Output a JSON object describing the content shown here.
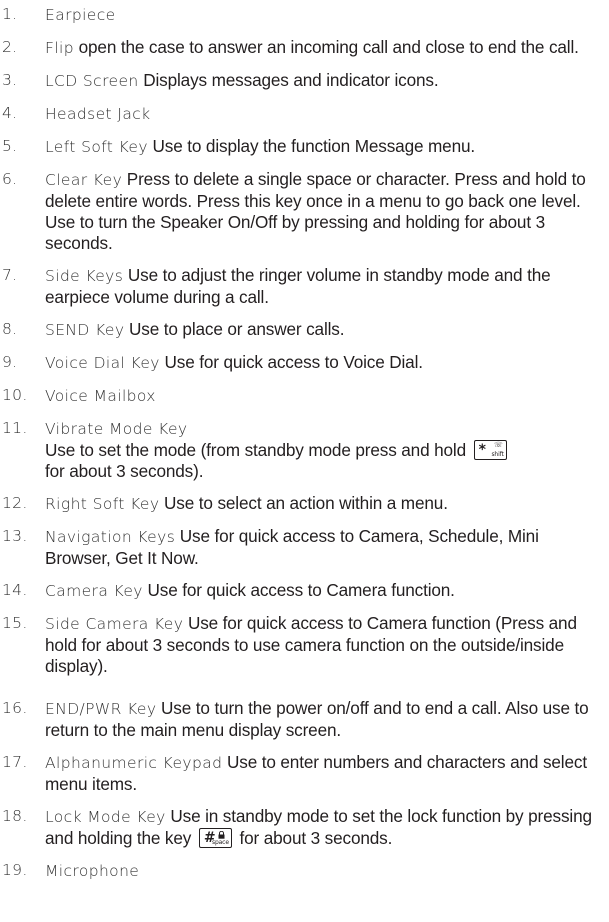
{
  "items": [
    {
      "num": "1.",
      "term": "Earpiece",
      "desc": ""
    },
    {
      "num": "2.",
      "term": "Flip",
      "desc": " open the case to answer an incoming call and close to end the call."
    },
    {
      "num": "3.",
      "term": "LCD Screen",
      "desc": " Displays messages and indicator icons."
    },
    {
      "num": "4.",
      "term": "Headset Jack",
      "desc": ""
    },
    {
      "num": "5.",
      "term": "Left Soft Key",
      "desc": " Use to display the function Message menu."
    },
    {
      "num": "6.",
      "term": "Clear Key",
      "desc": " Press to delete a single space or character. Press and hold to delete entire words. Press this key once in a menu to go back one level. Use to turn the Speaker On/Off by pressing and holding for about 3 seconds."
    },
    {
      "num": "7.",
      "term": "Side Keys",
      "desc": " Use to adjust the ringer volume in standby mode and the earpiece volume during a call."
    },
    {
      "num": "8.",
      "term": "SEND Key",
      "desc": " Use to place or answer calls."
    },
    {
      "num": "9.",
      "term": "Voice Dial Key",
      "desc": " Use for quick access to Voice Dial."
    },
    {
      "num": "10.",
      "term": "Voice Mailbox",
      "desc": ""
    },
    {
      "num": "11.",
      "term": "Vibrate Mode Key",
      "desc_before": "Use to set the mode (from standby mode press and hold",
      "desc_after": "for about 3 seconds).",
      "key": {
        "main": "*",
        "sub_top": "☏",
        "sub_bot": "shift"
      }
    },
    {
      "num": "12.",
      "term": "Right Soft Key",
      "desc": " Use to select an action within a menu."
    },
    {
      "num": "13.",
      "term": "Navigation Keys",
      "desc": " Use for quick access to Camera, Schedule, Mini Browser, Get It Now."
    },
    {
      "num": "14.",
      "term": "Camera Key",
      "desc": " Use for quick access to Camera function."
    },
    {
      "num": "15.",
      "term": "Side Camera Key",
      "desc": " Use for quick access to Camera function (Press and hold for about 3 seconds to use camera function on the outside/inside display)."
    },
    {
      "num": "16.",
      "term": "END/PWR Key",
      "desc": " Use to turn the power on/off and to end a call. Also use to return to the main menu display screen."
    },
    {
      "num": "17.",
      "term": "Alphanumeric Keypad",
      "desc": " Use to enter numbers and characters and select menu items."
    },
    {
      "num": "18.",
      "term": "Lock Mode Key",
      "desc_before": " Use in standby mode to set the lock function by pressing and holding the key",
      "desc_after": " for about 3 seconds.",
      "key": {
        "main": "#",
        "sub_bot": "space"
      }
    },
    {
      "num": "19.",
      "term": "Microphone",
      "desc": ""
    }
  ]
}
